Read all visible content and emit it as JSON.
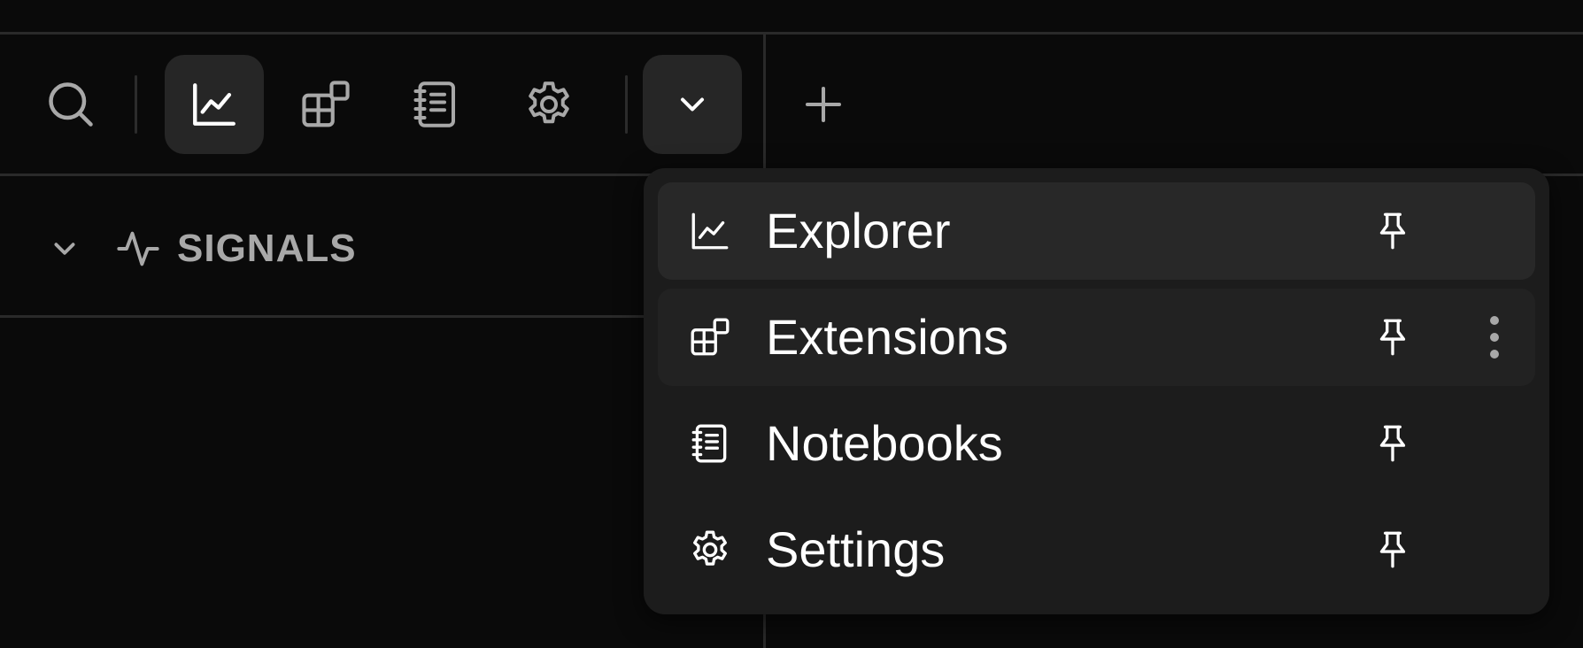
{
  "toolbar": {
    "buttons": [
      {
        "icon": "search-icon"
      },
      {
        "icon": "chart-line-icon",
        "active": true
      },
      {
        "icon": "extensions-icon"
      },
      {
        "icon": "notebook-icon"
      },
      {
        "icon": "gear-icon"
      },
      {
        "icon": "chevron-down-icon",
        "active": true
      },
      {
        "icon": "plus-icon"
      }
    ]
  },
  "sidebar": {
    "section_title": "SIGNALS",
    "section_icon": "activity-icon"
  },
  "menu": {
    "items": [
      {
        "label": "Explorer",
        "icon": "chart-line-icon",
        "state": "selected"
      },
      {
        "label": "Extensions",
        "icon": "extensions-icon",
        "state": "hovered"
      },
      {
        "label": "Notebooks",
        "icon": "notebook-icon",
        "state": "normal"
      },
      {
        "label": "Settings",
        "icon": "gear-icon",
        "state": "normal"
      }
    ]
  },
  "colors": {
    "background": "#0a0a0a",
    "divider": "#2a2a2a",
    "menu_bg": "#1c1c1c",
    "active_bg": "#262626",
    "icon_muted": "#a8a8a8",
    "text": "#ffffff"
  }
}
